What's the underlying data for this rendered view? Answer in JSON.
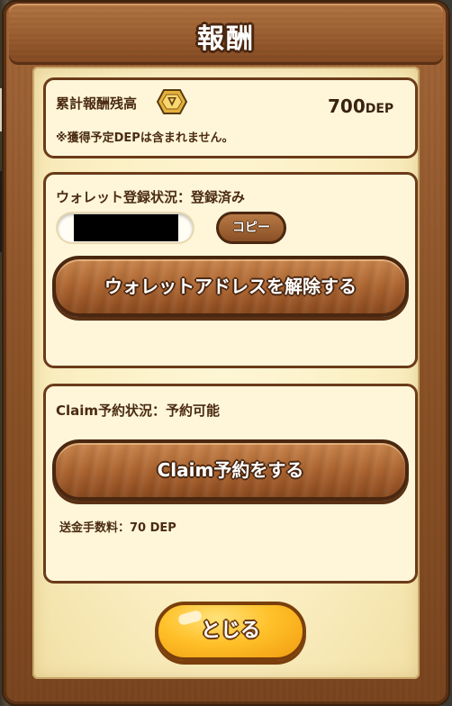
{
  "dialog": {
    "title": "報酬"
  },
  "reward": {
    "label": "累計報酬残高",
    "value": "700",
    "unit": "DEP",
    "note": "※獲得予定DEPは含まれません。",
    "icon": "dep-coin-icon"
  },
  "wallet": {
    "status_label": "ウォレット登録状況：登録済み",
    "address_value": "",
    "copy_label": "コピー",
    "unlink_label": "ウォレットアドレスを解除する"
  },
  "claim": {
    "status_label": "Claim予約状況：予約可能",
    "button_label": "Claim予約をする",
    "fee_label": "送金手数料：70 DEP"
  },
  "footer": {
    "close_label": "とじる"
  },
  "colors": {
    "wood": "#9a5c2e",
    "parchment": "#fbefc3",
    "card_border": "#6b3b1a",
    "close_button": "#ffc12a"
  }
}
